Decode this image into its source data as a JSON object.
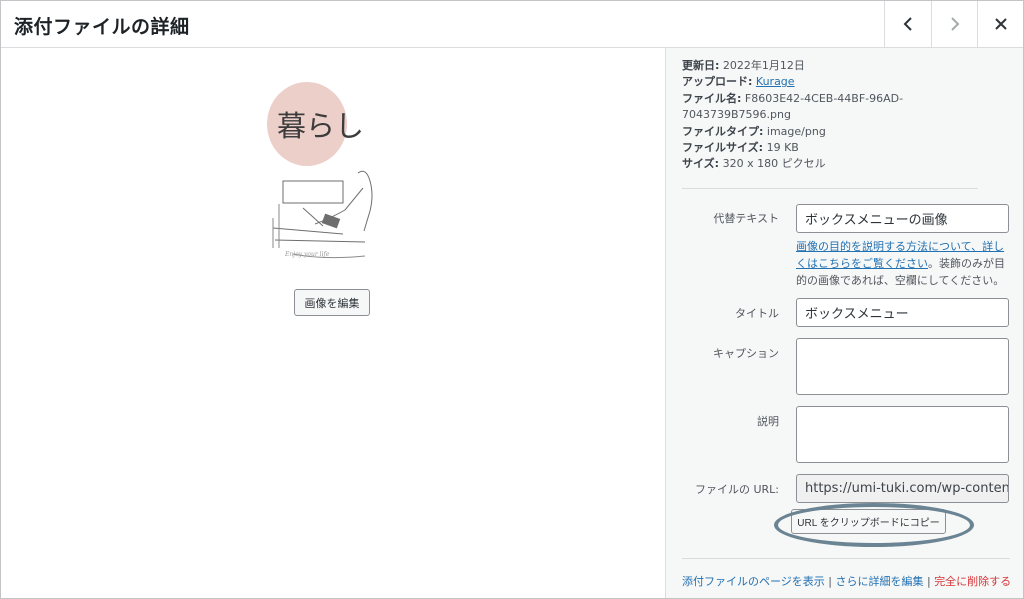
{
  "header": {
    "title": "添付ファイルの詳細",
    "prev_icon": "chevron-left-icon",
    "next_icon": "chevron-right-icon",
    "close_icon": "close-icon"
  },
  "preview": {
    "image_text": "暮らし",
    "image_subtext": "Enjoy your life",
    "edit_button": "画像を編集"
  },
  "meta": {
    "uploaded_label": "更新日:",
    "uploaded_value": "2022年1月12日",
    "uploader_label": "アップロード:",
    "uploader_value": "Kurage",
    "filename_label": "ファイル名:",
    "filename_value_1": "F8603E42-4CEB-44BF-96AD-",
    "filename_value_2": "7043739B7596.png",
    "filetype_label": "ファイルタイプ:",
    "filetype_value": "image/png",
    "filesize_label": "ファイルサイズ:",
    "filesize_value": "19 KB",
    "dimensions_label": "サイズ:",
    "dimensions_value": "320 x 180 ピクセル"
  },
  "form": {
    "alt_label": "代替テキスト",
    "alt_value": "ボックスメニューの画像",
    "alt_help_link": "画像の目的を説明する方法について、詳しくはこちらをご覧ください",
    "alt_help_text": "。装飾のみが目的の画像であれば、空欄にしてください。",
    "title_label": "タイトル",
    "title_value": "ボックスメニュー",
    "caption_label": "キャプション",
    "caption_value": "",
    "description_label": "説明",
    "description_value": "",
    "url_label": "ファイルの URL:",
    "url_value": "https://umi-tuki.com/wp-content/u",
    "copy_button": "URL をクリップボードにコピー"
  },
  "footer": {
    "view_link": "添付ファイルのページを表示",
    "sep": " | ",
    "edit_link": "さらに詳細を編集",
    "delete_link": "完全に削除する"
  },
  "colors": {
    "link": "#2271b1",
    "danger": "#d63638",
    "highlight_ring": "#6b8494"
  }
}
